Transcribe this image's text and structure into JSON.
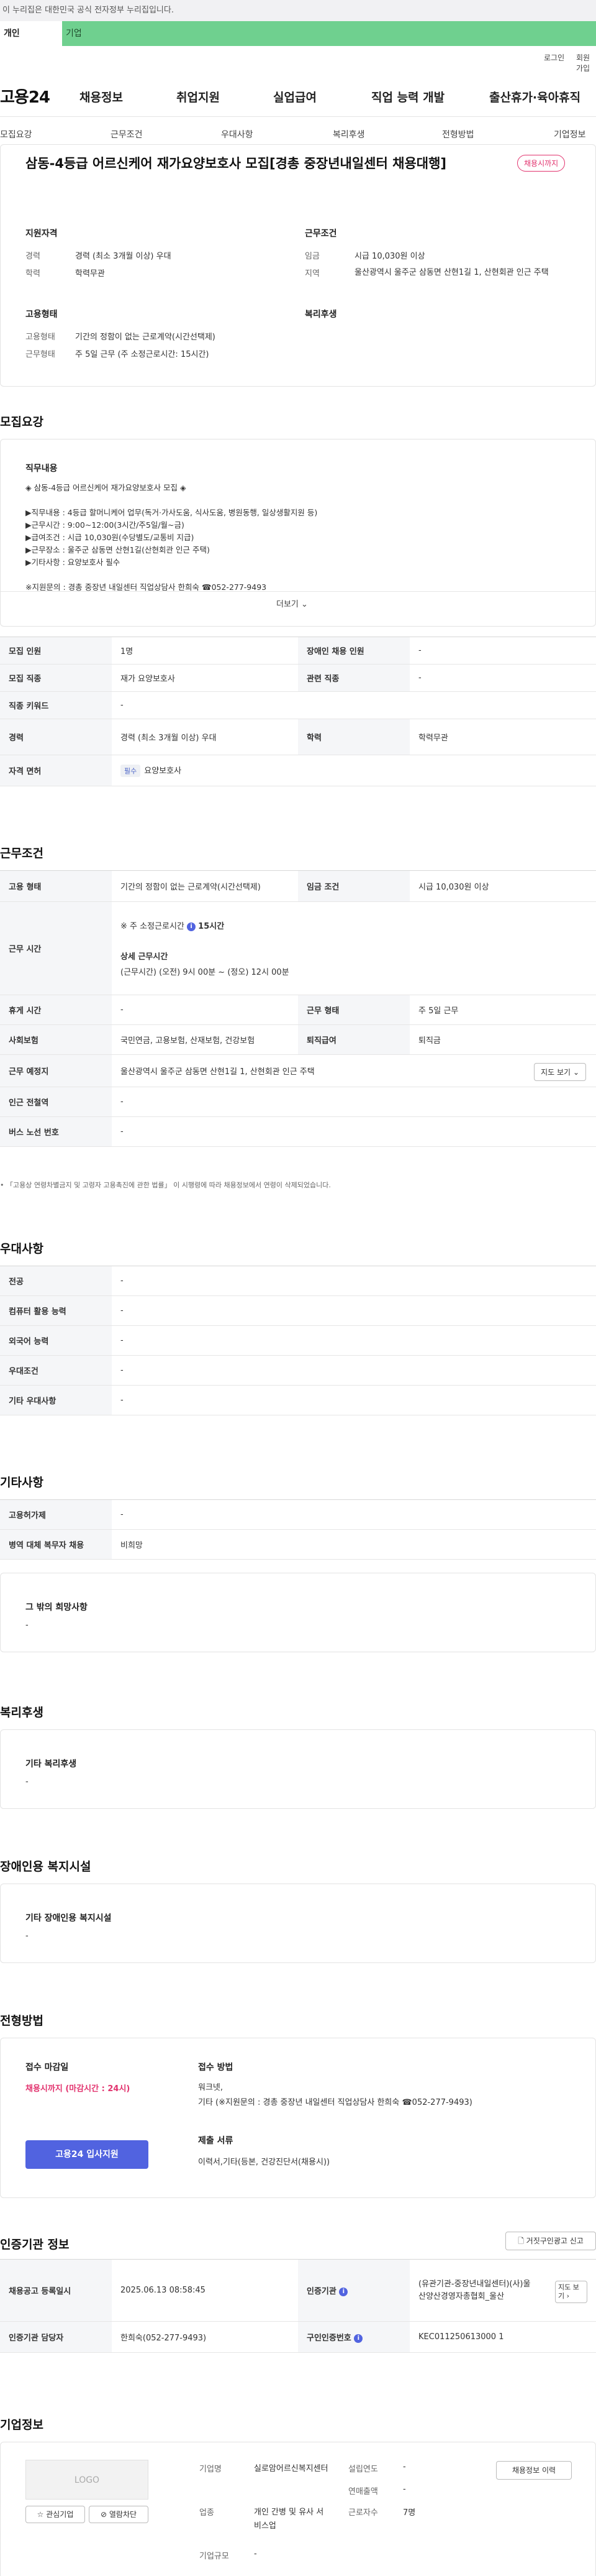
{
  "gov_banner": "이 누리집은 대한민국 공식 전자정부 누리집입니다.",
  "top_tabs": {
    "person": "개인",
    "company": "기업"
  },
  "util": {
    "login": "로그인",
    "signup": "회원가입"
  },
  "logo": "고용24",
  "gnb": [
    "채용정보",
    "취업지원",
    "실업급여",
    "직업 능력 개발",
    "출산휴가·육아휴직"
  ],
  "sub_nav": [
    "모집요강",
    "근무조건",
    "우대사항",
    "복리후생",
    "전형방법",
    "기업정보"
  ],
  "job": {
    "title": "삼동-4등급 어르신케어 재가요양보호사 모집[경총 중장년내일센터 채용대행]",
    "status": "채용시까지",
    "qual_title": "지원자격",
    "qual": [
      {
        "label": "경력",
        "value": "경력 (최소 3개월 이상) 우대"
      },
      {
        "label": "학력",
        "value": "학력무관"
      }
    ],
    "cond_title": "근무조건",
    "cond": [
      {
        "label": "임금",
        "value": "시급 10,030원 이상"
      },
      {
        "label": "지역",
        "value": "울산광역시 울주군 삼동면 산현1길 1, 산현회관 인근 주택"
      }
    ],
    "emp_title": "고용형태",
    "emp": [
      {
        "label": "고용형태",
        "value": "기간의 정함이 없는 근로계약(시간선택제)"
      },
      {
        "label": "근무형태",
        "value": "주 5일 근무 (주 소정근로시간: 15시간)"
      }
    ],
    "welfare_title": "복리후생"
  },
  "recruit": {
    "title": "모집요강",
    "duty_title": "직무내용",
    "duty_text": "◈ 삼동-4등급 어르신케어 재가요양보호사 모집 ◈\n\n▶직무내용 : 4등급 할머니케어 업무(독거·가사도움, 식사도움, 병원동행, 일상생활지원 등)\n▶근무시간 : 9:00~12:00(3시간/주5일/월~금)\n▶급여조건 : 시급 10,030원(수당별도/교통비 지급)\n▶근무장소 : 울주군 삼동면 산현1길(산현회관 인근 주택)\n▶기타사항 : 요양보호사 필수\n\n※지원문의 : 경총 중장년 내일센터 직업상담사 한희숙 ☎052-277-9493",
    "more": "더보기",
    "rows": {
      "count_l": "모집 인원",
      "count_v": "1명",
      "disabled_l": "장애인 채용 인원",
      "disabled_v": "-",
      "job_l": "모집 직종",
      "job_v": "재가 요양보호사",
      "rel_l": "관련 직종",
      "rel_v": "-",
      "kw_l": "직종 키워드",
      "kw_v": "-",
      "career_l": "경력",
      "career_v": "경력 (최소 3개월 이상) 우대",
      "edu_l": "학력",
      "edu_v": "학력무관",
      "license_l": "자격 면허",
      "license_tag": "필수",
      "license_v": "요양보호사"
    }
  },
  "work": {
    "title": "근무조건",
    "type_l": "고용 형태",
    "type_v": "기간의 정함이 없는 근로계약(시간선택제)",
    "wage_l": "임금 조건",
    "wage_v": "시급 10,030원 이상",
    "hours_l": "근무 시간",
    "hours_week": "주 소정근로시간",
    "hours_num": "15시간",
    "hours_detail_title": "상세 근무시간",
    "hours_detail": "(근무시간) (오전) 9시 00분 ~ (정오) 12시 00분",
    "rest_l": "휴게 시간",
    "rest_v": "-",
    "form_l": "근무 형태",
    "form_v": "주 5일 근무",
    "ins_l": "사회보험",
    "ins_v": "국민연금, 고용보험, 산재보험, 건강보험",
    "retire_l": "퇴직급여",
    "retire_v": "퇴직금",
    "place_l": "근무 예정지",
    "place_v": "울산광역시 울주군 삼동면 산현1길 1, 산현회관 인근 주택",
    "map_btn": "지도 보기",
    "subway_l": "인근 전철역",
    "subway_v": "-",
    "bus_l": "버스 노선 번호",
    "bus_v": "-",
    "notice": "「고용상 연령차별금지 및 고령자 고용촉진에 관한 법률」 이 시행령에 따라 채용정보에서 연령이 삭제되었습니다."
  },
  "pref": {
    "title": "우대사항",
    "rows": [
      {
        "l": "전공",
        "v": "-"
      },
      {
        "l": "컴퓨터 활용 능력",
        "v": "-"
      },
      {
        "l": "외국어 능력",
        "v": "-"
      },
      {
        "l": "우대조건",
        "v": "-"
      },
      {
        "l": "기타 우대사항",
        "v": "-"
      }
    ]
  },
  "etc": {
    "title": "기타사항",
    "rows": [
      {
        "l": "고용허가제",
        "v": "-"
      },
      {
        "l": "병역 대체 복무자 채용",
        "v": "비희망"
      }
    ],
    "other_title": "그 밖의 희망사항",
    "other_v": "-"
  },
  "welfare": {
    "title": "복리후생",
    "box_title": "기타 복리후생",
    "box_v": "-"
  },
  "disabled": {
    "title": "장애인용 복지시설",
    "box_title": "기타 장애인용 복지시설",
    "box_v": "-"
  },
  "selection": {
    "title": "전형방법",
    "deadline_l": "접수 마감일",
    "deadline_v": "채용시까지 (마감시간 : 24시)",
    "apply_btn": "고용24 입사지원",
    "method_l": "접수 방법",
    "method_v": "워크넷,\n기타 (※지원문의 : 경총 중장년 내일센터 직업상담사 한희숙 ☎052-277-9493)",
    "docs_l": "제출 서류",
    "docs_v": "이력서,기타(등본, 건강진단서(채용시))"
  },
  "cert": {
    "title": "인증기관 정보",
    "report_btn": "거짓구인광고 신고",
    "reg_l": "채용공고 등록일시",
    "reg_v": "2025.06.13 08:58:45",
    "org_l": "인증기관",
    "org_v": "(유관기관-중장년내일센터)(사)울산양산경영자총협회_울산",
    "map_btn": "지도 보기",
    "mgr_l": "인증기관 담당자",
    "mgr_v": "한희숙(052-277-9493)",
    "no_l": "구인인증번호",
    "no_v": "KEC011250613000 1"
  },
  "company": {
    "title": "기업정보",
    "logo": "LOGO",
    "fav_btn": "관심기업",
    "block_btn": "열람차단",
    "name_l": "기업명",
    "name_v": "실로암어르신복지센터",
    "year_l": "설립연도",
    "year_v": "-",
    "sales_l": "연매출액",
    "sales_v": "-",
    "ind_l": "업종",
    "ind_v": "개인 간병 및 유사 서비스업",
    "emp_l": "근로자수",
    "emp_v": "7명",
    "scale_l": "기업규모",
    "scale_v": "-",
    "history_btn": "채용정보 이력"
  }
}
